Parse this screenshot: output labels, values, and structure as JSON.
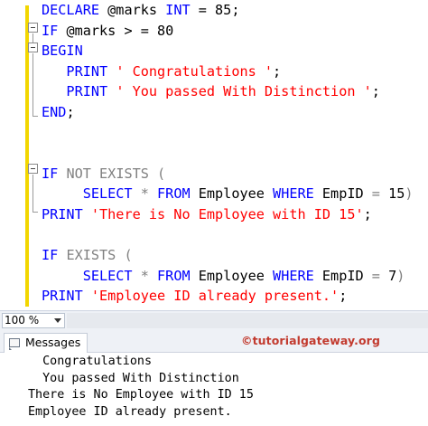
{
  "editor": {
    "lines": [
      {
        "parts": [
          {
            "t": "DECLARE",
            "c": "kw"
          },
          {
            "t": " @marks ",
            "c": "blk"
          },
          {
            "t": "INT",
            "c": "kw"
          },
          {
            "t": " = 85;",
            "c": "blk"
          }
        ]
      },
      {
        "parts": [
          {
            "t": "IF",
            "c": "kw"
          },
          {
            "t": " @marks > = 80",
            "c": "blk"
          }
        ]
      },
      {
        "parts": [
          {
            "t": "BEGIN",
            "c": "kw"
          }
        ]
      },
      {
        "parts": [
          {
            "t": "   PRINT",
            "c": "kw"
          },
          {
            "t": " ",
            "c": "blk"
          },
          {
            "t": "' Congratulations '",
            "c": "str"
          },
          {
            "t": ";",
            "c": "blk"
          }
        ]
      },
      {
        "parts": [
          {
            "t": "   PRINT",
            "c": "kw"
          },
          {
            "t": " ",
            "c": "blk"
          },
          {
            "t": "' You passed With Distinction '",
            "c": "str"
          },
          {
            "t": ";",
            "c": "blk"
          }
        ]
      },
      {
        "parts": [
          {
            "t": "END",
            "c": "kw"
          },
          {
            "t": ";",
            "c": "blk"
          }
        ]
      },
      {
        "parts": []
      },
      {
        "parts": []
      },
      {
        "parts": [
          {
            "t": "IF",
            "c": "kw"
          },
          {
            "t": " ",
            "c": "blk"
          },
          {
            "t": "NOT EXISTS",
            "c": "gray"
          },
          {
            "t": " (",
            "c": "gray"
          }
        ]
      },
      {
        "parts": [
          {
            "t": "     SELECT",
            "c": "kw"
          },
          {
            "t": " * ",
            "c": "gray"
          },
          {
            "t": "FROM",
            "c": "kw"
          },
          {
            "t": " Employee ",
            "c": "blk"
          },
          {
            "t": "WHERE",
            "c": "kw"
          },
          {
            "t": " EmpID ",
            "c": "blk"
          },
          {
            "t": "=",
            "c": "gray"
          },
          {
            "t": " 15",
            "c": "blk"
          },
          {
            "t": ")",
            "c": "gray"
          }
        ]
      },
      {
        "parts": [
          {
            "t": "PRINT",
            "c": "kw"
          },
          {
            "t": " ",
            "c": "blk"
          },
          {
            "t": "'There is No Employee with ID 15'",
            "c": "str"
          },
          {
            "t": ";",
            "c": "blk"
          }
        ]
      },
      {
        "parts": []
      },
      {
        "parts": [
          {
            "t": "IF",
            "c": "kw"
          },
          {
            "t": " ",
            "c": "blk"
          },
          {
            "t": "EXISTS",
            "c": "gray"
          },
          {
            "t": " (",
            "c": "gray"
          }
        ]
      },
      {
        "parts": [
          {
            "t": "     SELECT",
            "c": "kw"
          },
          {
            "t": " * ",
            "c": "gray"
          },
          {
            "t": "FROM",
            "c": "kw"
          },
          {
            "t": " Employee ",
            "c": "blk"
          },
          {
            "t": "WHERE",
            "c": "kw"
          },
          {
            "t": " EmpID ",
            "c": "blk"
          },
          {
            "t": "=",
            "c": "gray"
          },
          {
            "t": " 7",
            "c": "blk"
          },
          {
            "t": ")",
            "c": "gray"
          }
        ]
      },
      {
        "parts": [
          {
            "t": "PRINT",
            "c": "kw"
          },
          {
            "t": " ",
            "c": "blk"
          },
          {
            "t": "'Employee ID already present.'",
            "c": "str"
          },
          {
            "t": ";",
            "c": "blk"
          }
        ]
      }
    ]
  },
  "statusbar": {
    "zoom": "100 %"
  },
  "results": {
    "tab_label": "Messages",
    "watermark": "©tutorialgateway.org",
    "messages": [
      "  Congratulations ",
      "  You passed With Distinction ",
      "There is No Employee with ID 15",
      "Employee ID already present."
    ]
  },
  "colors": {
    "keyword": "#0000ff",
    "string": "#ff0000",
    "operator": "#808080",
    "watermark": "#c23a2e"
  }
}
